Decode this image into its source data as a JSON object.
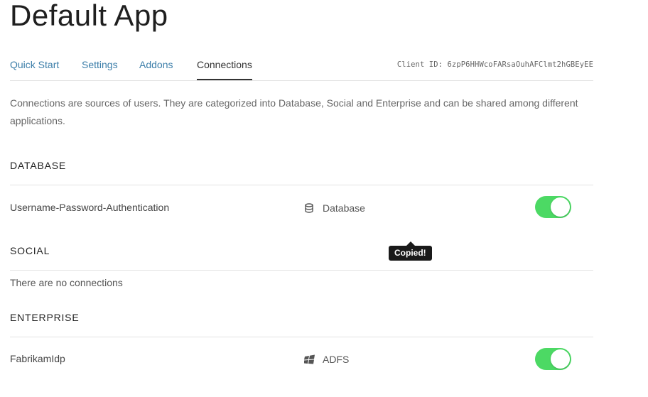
{
  "app": {
    "title": "Default App"
  },
  "tabs": [
    {
      "label": "Quick Start"
    },
    {
      "label": "Settings"
    },
    {
      "label": "Addons"
    },
    {
      "label": "Connections"
    }
  ],
  "active_tab": "Connections",
  "client_id": {
    "label": "Client ID:",
    "value": "6zpP6HHWcoFARsaOuhAFClmt2hGBEyEE",
    "full_text": "Client ID: 6zpP6HHWcoFARsaOuhAFClmt2hGBEyEE"
  },
  "description": "Connections are sources of users. They are categorized into Database, Social and Enterprise and can be shared among different applications.",
  "sections": {
    "database": {
      "heading": "DATABASE",
      "connections": [
        {
          "name": "Username-Password-Authentication",
          "type": "Database",
          "type_icon": "database-icon",
          "enabled": true
        }
      ]
    },
    "social": {
      "heading": "SOCIAL",
      "empty_text": "There are no connections"
    },
    "enterprise": {
      "heading": "ENTERPRISE",
      "connections": [
        {
          "name": "FabrikamIdp",
          "type": "ADFS",
          "type_icon": "windows-icon",
          "enabled": true
        }
      ]
    }
  },
  "tooltip": {
    "text": "Copied!"
  },
  "colors": {
    "link": "#3c7ea9",
    "toggle_on": "#4cd964",
    "tooltip_bg": "#1a1a1a"
  }
}
